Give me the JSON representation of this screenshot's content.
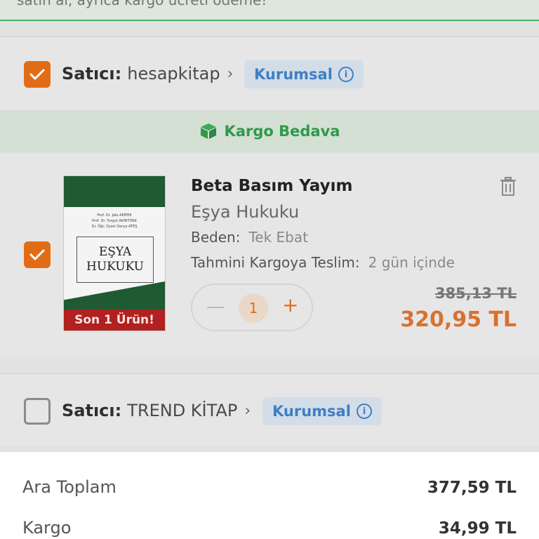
{
  "banner": {
    "text": "satın al, ayrıca kargo ücreti ödeme!"
  },
  "sellers": [
    {
      "prefix": "Satıcı:",
      "name": "hesapkitap",
      "badge": "Kurumsal",
      "checked": true
    },
    {
      "prefix": "Satıcı:",
      "name": "TREND KİTAP",
      "badge": "Kurumsal",
      "checked": false
    }
  ],
  "shipping": {
    "label": "Kargo Bedava"
  },
  "product": {
    "brand": "Beta Basım Yayım",
    "title": "Eşya Hukuku",
    "size_label": "Beden:",
    "size_value": "Tek Ebat",
    "delivery_label": "Tahmini Kargoya Teslim:",
    "delivery_value": "2 gün içinde",
    "quantity": "1",
    "old_price": "385,13 TL",
    "price": "320,95 TL",
    "stock_badge": "Son 1 Ürün!",
    "cover": {
      "authors": [
        "Prof. Dr. Jale AKİPEK",
        "Prof. Dr. Turgut AKINTÜRK",
        "Dr. Öğr. Üyesi Derya ATEŞ"
      ],
      "title_line1": "EŞYA",
      "title_line2": "HUKUKU"
    }
  },
  "summary": {
    "subtotal_label": "Ara Toplam",
    "subtotal_value": "377,59 TL",
    "shipping_label": "Kargo",
    "shipping_value": "34,99 TL"
  },
  "colors": {
    "accent": "#e06d16",
    "green": "#2f9a4a",
    "badge_blue": "#3f7fc2",
    "stock_red": "#b0211f"
  },
  "icons": [
    "checkmark-icon",
    "chevron-right-icon",
    "info-icon",
    "package-icon",
    "trash-icon",
    "minus-icon",
    "plus-icon"
  ]
}
